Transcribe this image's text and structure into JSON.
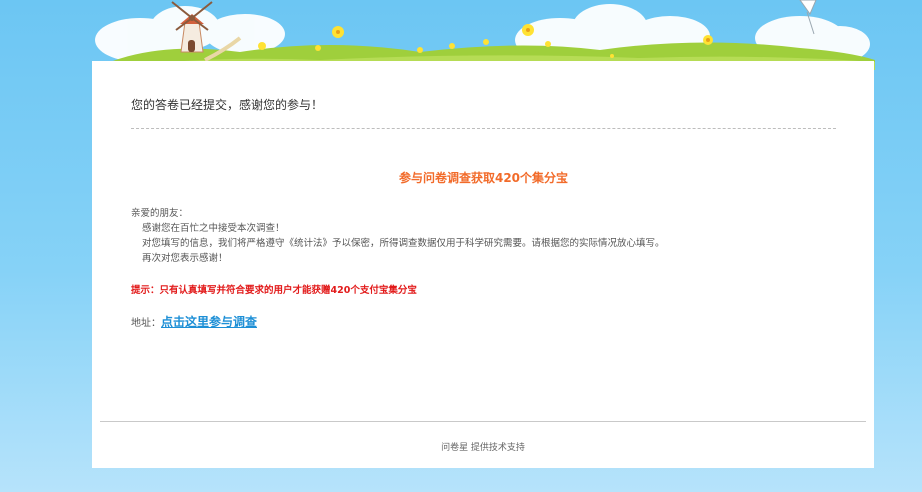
{
  "confirmation": {
    "headline": "您的答卷已经提交，感谢您的参与！"
  },
  "promo": {
    "title": "参与问卷调查获取420个集分宝",
    "greeting": "亲爱的朋友：",
    "lines": [
      "感谢您在百忙之中接受本次调查！",
      "对您填写的信息，我们将严格遵守《统计法》予以保密，所得调查数据仅用于科学研究需要。请根据您的实际情况放心填写。",
      "再次对您表示感谢！"
    ],
    "tip": "提示：只有认真填写并符合要求的用户才能获赠420个支付宝集分宝",
    "address_label": "地址：",
    "address_link": "点击这里参与调查"
  },
  "footer": {
    "text": "问卷星 提供技术支持"
  },
  "colors": {
    "promo_title": "#f26b2a",
    "tip": "#e21a1a",
    "link": "#1d8fd6",
    "sky": "#6cc6f3",
    "grass": "#9fcf3c"
  },
  "icons": [
    "windmill-icon",
    "kite-icon",
    "flower-icon"
  ]
}
